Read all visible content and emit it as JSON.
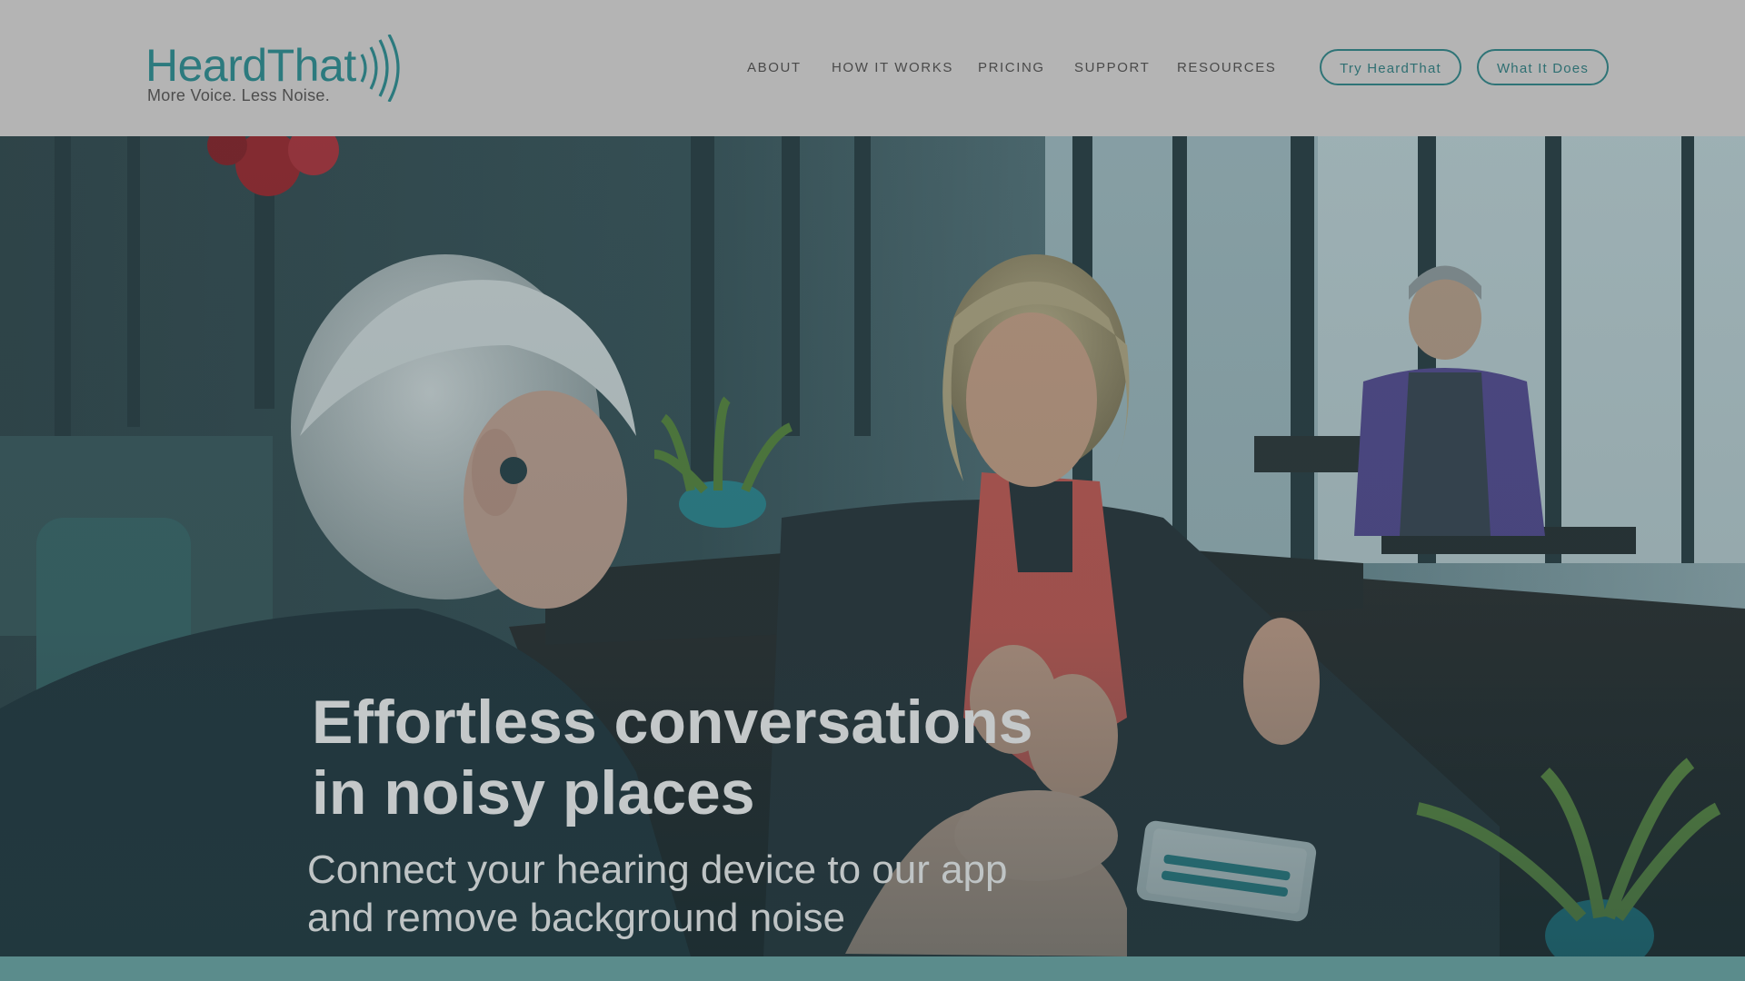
{
  "brand": {
    "name": "HeardThat",
    "tagline": "More Voice. Less Noise.",
    "color": "#2c7a7e"
  },
  "nav": {
    "items": [
      {
        "label": "ABOUT"
      },
      {
        "label": "HOW IT WORKS"
      },
      {
        "label": "PRICING"
      },
      {
        "label": "SUPPORT"
      },
      {
        "label": "RESOURCES"
      }
    ]
  },
  "cta": {
    "try_label": "Try HeardThat",
    "what_label": "What It Does",
    "border_color": "#2f7477"
  },
  "hero": {
    "title_line1": "Effortless conversations",
    "title_line2": "in noisy places",
    "subtitle_line1": "Connect your hearing device to our app",
    "subtitle_line2": "and remove background noise"
  },
  "colors": {
    "header_bg": "#b4b4b4",
    "footer_bar": "#5b8c8c",
    "hero_overlay": "#1e3a40"
  }
}
